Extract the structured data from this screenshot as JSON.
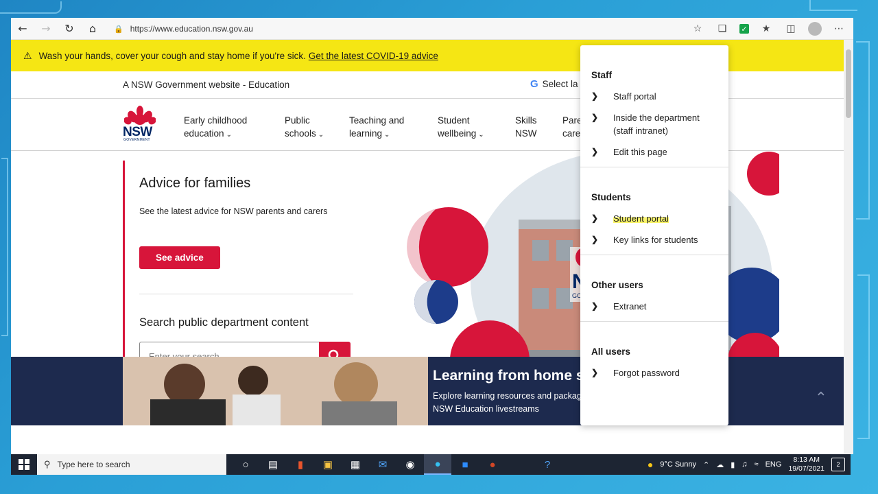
{
  "browser": {
    "url": "https://www.education.nsw.gov.au"
  },
  "alert": {
    "message": "Wash your hands, cover your cough and stay home if you're sick.",
    "link": "Get the latest COVID-19 advice"
  },
  "gov_bar": {
    "text": "A NSW Government website - Education",
    "language": "Select la"
  },
  "logo": {
    "name": "NSW",
    "sub": "GOVERNMENT"
  },
  "nav": [
    {
      "line1": "Early childhood",
      "line2": "education"
    },
    {
      "line1": "Public",
      "line2": "schools"
    },
    {
      "line1": "Teaching and",
      "line2": "learning"
    },
    {
      "line1": "Student",
      "line2": "wellbeing"
    },
    {
      "line1": "Skills",
      "line2": "NSW"
    },
    {
      "line1": "Pare",
      "line2": "care"
    }
  ],
  "hero": {
    "title": "Advice for families",
    "subtitle": "See the latest advice for NSW parents and carers",
    "button": "See advice",
    "search_title": "Search public department content",
    "search_placeholder": "Enter your search..."
  },
  "banner": {
    "title": "Learning from home support",
    "text": "Explore learning resources and packages for your child or tune in to the daily NSW Education livestreams"
  },
  "dropdown": {
    "sections": [
      {
        "heading": "Staff",
        "items": [
          "Staff portal",
          "Inside the department (staff intranet)",
          "Edit this page"
        ]
      },
      {
        "heading": "Students",
        "items": [
          "Student portal",
          "Key links for students"
        ]
      },
      {
        "heading": "Other users",
        "items": [
          "Extranet"
        ]
      },
      {
        "heading": "All users",
        "items": [
          "Forgot password"
        ]
      }
    ]
  },
  "taskbar": {
    "search_placeholder": "Type here to search",
    "weather": "9°C  Sunny",
    "lang": "ENG",
    "time": "8:13 AM",
    "date": "19/07/2021",
    "notifications": "2"
  },
  "colors": {
    "nsw_red": "#d7153a",
    "nsw_navy": "#002664",
    "alert_yellow": "#f5e614",
    "highlight": "#f9f46b"
  }
}
